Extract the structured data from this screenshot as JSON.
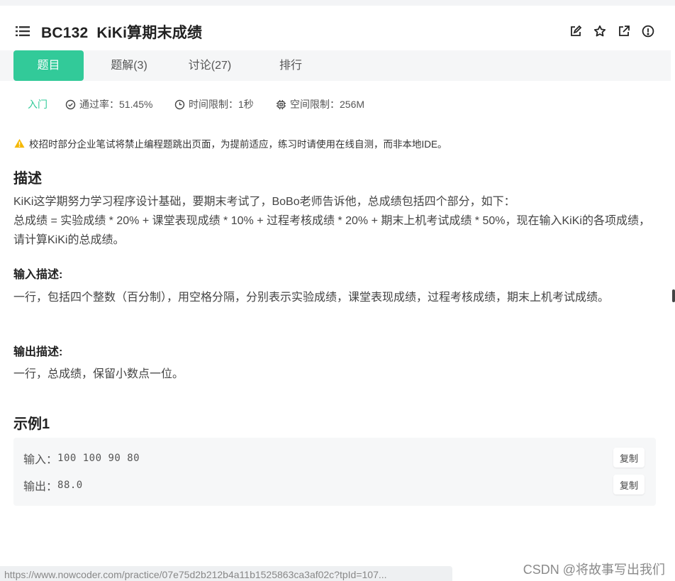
{
  "header": {
    "problem_code": "BC132",
    "problem_title": "KiKi算期末成绩"
  },
  "tabs": [
    {
      "label": "题目"
    },
    {
      "label": "题解(3)"
    },
    {
      "label": "讨论(27)"
    },
    {
      "label": "排行"
    }
  ],
  "meta": {
    "level": "入门",
    "pass_rate": "通过率：51.45%",
    "time_limit": "时间限制：1秒",
    "space_limit": "空间限制：256M"
  },
  "warning": "校招时部分企业笔试将禁止编程题跳出页面，为提前适应，练习时请使用在线自测，而非本地IDE。",
  "description": {
    "heading": "描述",
    "line1": "KiKi这学期努力学习程序设计基础，要期末考试了，BoBo老师告诉他，总成绩包括四个部分，如下：",
    "line2": "总成绩 = 实验成绩 * 20% + 课堂表现成绩 * 10% + 过程考核成绩 * 20% + 期末上机考试成绩 * 50%，现在输入KiKi的各项成绩，请计算KiKi的总成绩。"
  },
  "input_desc": {
    "heading": "输入描述:",
    "text": "一行，包括四个整数（百分制），用空格分隔，分别表示实验成绩，课堂表现成绩，过程考核成绩，期末上机考试成绩。"
  },
  "output_desc": {
    "heading": "输出描述:",
    "text": "一行，总成绩，保留小数点一位。"
  },
  "example": {
    "heading": "示例1",
    "input_label": "输入：",
    "input_value": "100 100 90 80",
    "output_label": "输出：",
    "output_value": "88.0",
    "copy_label": "复制"
  },
  "status_url": "https://www.nowcoder.com/practice/07e75d2b212b4a11b1525863ca3af02c?tpId=107...",
  "watermark": "CSDN @将故事写出我们",
  "colors": {
    "accent": "#32ca99",
    "warning": "#f5b800"
  }
}
